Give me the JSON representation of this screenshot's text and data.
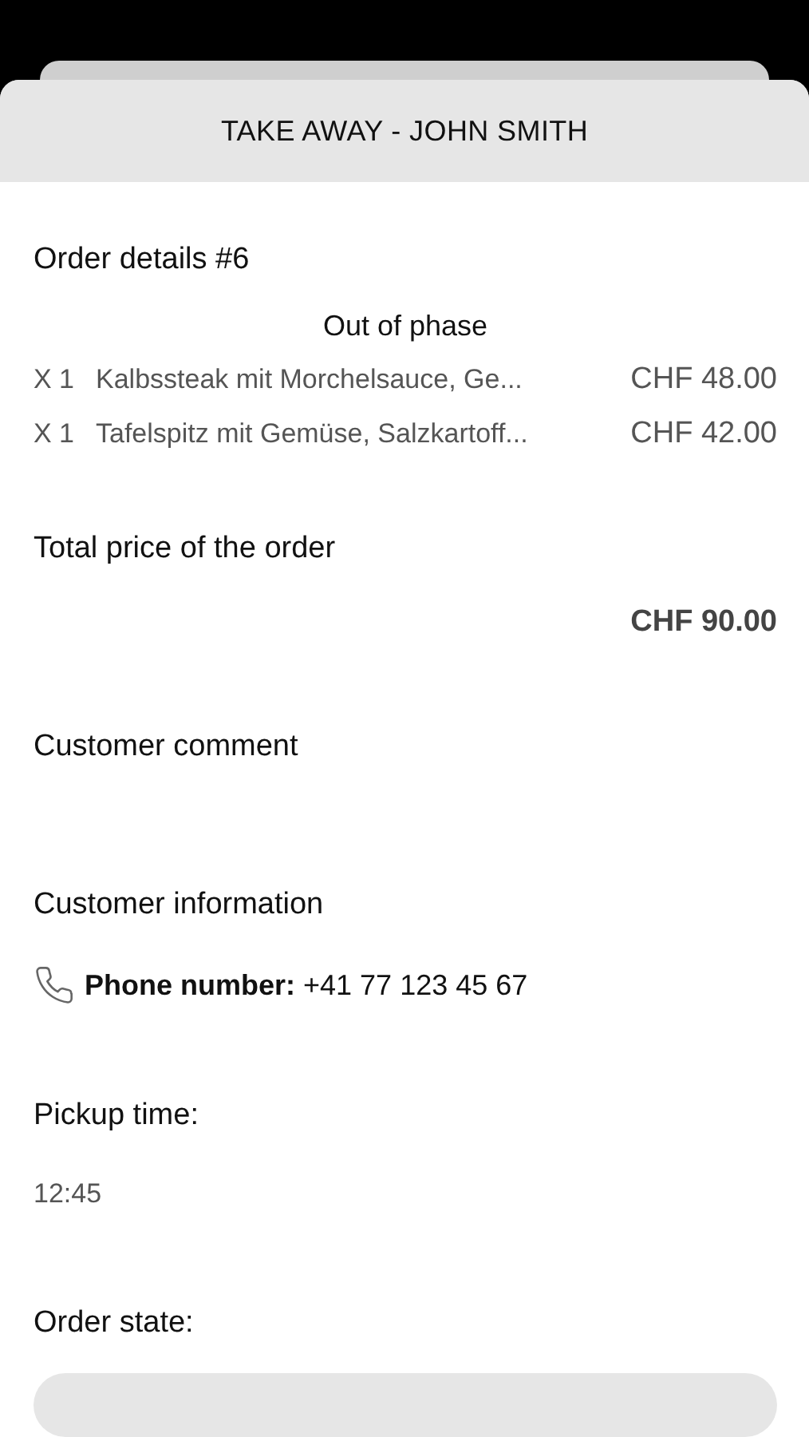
{
  "header": {
    "title": "TAKE AWAY - JOHN SMITH"
  },
  "order": {
    "title": "Order details #6",
    "phase": "Out of phase",
    "items": [
      {
        "quantity": "X 1",
        "name": "Kalbssteak mit Morchelsauce, Ge...",
        "price": "CHF 48.00"
      },
      {
        "quantity": "X 1",
        "name": "Tafelspitz mit Gemüse, Salzkartoff...",
        "price": "CHF 42.00"
      }
    ]
  },
  "total": {
    "title": "Total price of the order",
    "value": "CHF 90.00"
  },
  "comment": {
    "title": "Customer comment"
  },
  "customer": {
    "title": "Customer information",
    "phone": "**Phone number:** +41 77 123 45 67"
  },
  "pickup": {
    "title": "Pickup time:",
    "value": "12:45"
  },
  "state": {
    "title": "Order state:"
  }
}
